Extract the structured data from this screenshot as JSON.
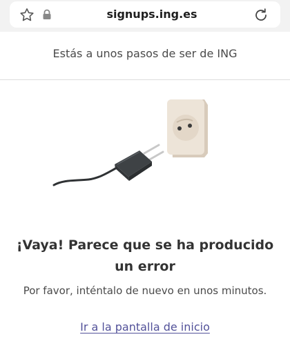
{
  "browser": {
    "url": "signups.ing.es",
    "icons": {
      "favorite": "star-icon",
      "security": "lock-icon",
      "reload": "reload-icon"
    }
  },
  "header": {
    "title": "Estás a unos pasos de ser de ING"
  },
  "illustration": {
    "name": "unplugged-cable-illustration"
  },
  "error": {
    "title": "¡Vaya! Parece que se ha producido un error",
    "message": "Por favor, inténtalo de nuevo en unos minutos."
  },
  "links": {
    "home": "Ir a la pantalla de inicio"
  },
  "colors": {
    "link": "#525199",
    "text": "#333333",
    "socket": "#ede4d8"
  }
}
